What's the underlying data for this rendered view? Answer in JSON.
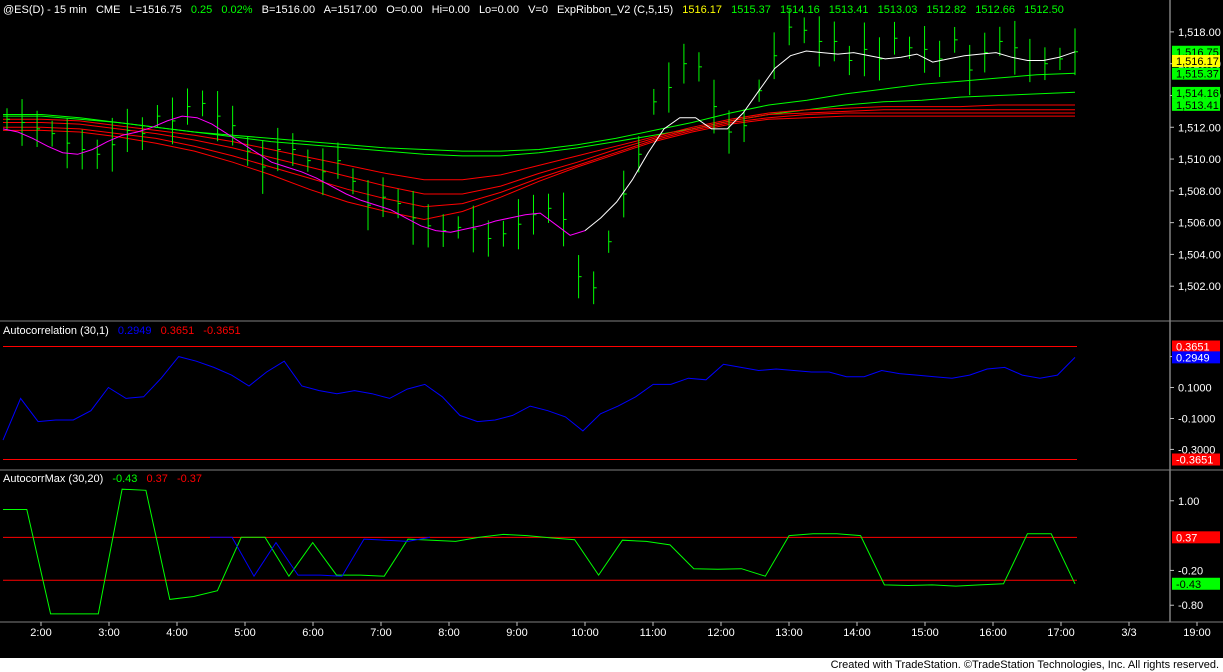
{
  "header": {
    "symbol": "@ES(D) - 15 min",
    "exchange": "CME",
    "last": "L=1516.75",
    "change": "0.25",
    "change_pct": "0.02%",
    "bid": "B=1516.00",
    "ask": "A=1517.00",
    "open": "O=0.00",
    "hi": "Hi=0.00",
    "lo": "Lo=0.00",
    "vol": "V=0",
    "ribbon_name": "ExpRibbon_V2 (C,5,15)",
    "ribbon_values": [
      "1516.17",
      "1515.37",
      "1514.16",
      "1513.41",
      "1513.03",
      "1512.82",
      "1512.66",
      "1512.50"
    ]
  },
  "panel2_header": {
    "name": "Autocorrelation (30,1)",
    "values": [
      "0.2949",
      "0.3651",
      "-0.3651"
    ]
  },
  "panel3_header": {
    "name": "AutocorrMax (30,20)",
    "values": [
      "-0.43",
      "0.37",
      "-0.37"
    ]
  },
  "footer": {
    "text": "Created with TradeStation. ©TradeStation Technologies, Inc. All rights reserved."
  },
  "colors": {
    "background": "#000000",
    "bar": "#00ff00",
    "price_line": "#ffffff",
    "ribbon_green": "#00ff00",
    "ribbon_red": "#ff0000",
    "autocorr_line": "#0000ff",
    "threshold_line": "#ff0000",
    "tag_red": "#ff0000",
    "tag_blue": "#0000ff",
    "tag_yellow": "#ffff00",
    "tag_green": "#00ff00"
  },
  "chart_data": [
    {
      "type": "line",
      "name": "price",
      "ylim": [
        1500,
        1519
      ],
      "ytick_labels": [
        "1,518.00",
        "1,516.00",
        "1,514.00",
        "1,512.00",
        "1,510.00",
        "1,508.00",
        "1,506.00",
        "1,504.00",
        "1,502.00"
      ],
      "yticks": [
        1518,
        1516,
        1514,
        1512,
        1510,
        1508,
        1506,
        1504,
        1502
      ],
      "value_tags": [
        {
          "label": "1,516.75",
          "value": 1516.75,
          "color": "#00ff00"
        },
        {
          "label": "1,516.17",
          "value": 1516.17,
          "color": "#ffff00"
        },
        {
          "label": "1,515.37",
          "value": 1515.37,
          "color": "#00ff00"
        },
        {
          "label": "1,514.16",
          "value": 1514.16,
          "color": "#00ff00"
        },
        {
          "label": "1,513.41",
          "value": 1513.41,
          "color": "#00ff00"
        }
      ],
      "series": [
        {
          "color": "#00ff00",
          "role": "bars",
          "values": [
            1512.5,
            1512.3,
            1511.9,
            1511.6,
            1511.0,
            1510.6,
            1510.3,
            1510.9,
            1511.8,
            1511.6,
            1512.7,
            1512.4,
            1513.3,
            1513.5,
            1512.7,
            1512.1,
            1510.5,
            1509.5,
            1510.6,
            1510.6,
            1509.9,
            1509.2,
            1509.9,
            1508.6,
            1507.1,
            1507.6,
            1507.2,
            1506.3,
            1505.8,
            1505.5,
            1505.7,
            1505.6,
            1505.0,
            1505.3,
            1505.9,
            1506.5,
            1506.9,
            1506.2,
            1502.6,
            1501.9,
            1504.8,
            1507.8,
            1510.3,
            1513.6,
            1514.5,
            1516.0,
            1515.8,
            1513.3,
            1511.7,
            1512.1,
            1514.3,
            1516.5,
            1518.3,
            1518.1,
            1517.4,
            1517.4,
            1516.2,
            1516.9,
            1516.3,
            1517.6,
            1517.0,
            1516.9,
            1516.3,
            1517.5,
            1515.6,
            1516.7,
            1517.4,
            1517.0,
            1516.2,
            1516.0,
            1516.3,
            1516.75
          ]
        },
        {
          "color": "#ff00ff",
          "role": "close-before-turn",
          "values": [
            1511.9,
            1511.7,
            1511.3,
            1510.8,
            1510.4,
            1510.3,
            1510.6,
            1511.1,
            1511.5,
            1511.7,
            1512.0,
            1512.4,
            1512.7,
            1512.6,
            1512.2,
            1511.6,
            1511.0,
            1510.4,
            1509.8,
            1509.5,
            1509.2,
            1508.8,
            1508.3,
            1507.8,
            1507.4,
            1507.1,
            1506.8,
            1506.3,
            1505.8,
            1505.5,
            1505.4,
            1505.6,
            1505.8,
            1506.1,
            1506.3,
            1506.5,
            1506.6,
            1505.9,
            1505.2,
            1505.5
          ]
        },
        {
          "color": "#ffffff",
          "role": "close-after-turn",
          "values": [
            1505.5,
            1506.3,
            1507.3,
            1508.7,
            1510.4,
            1511.9,
            1512.6,
            1512.6,
            1511.9,
            1511.9,
            1512.9,
            1514.3,
            1515.7,
            1516.5,
            1516.8,
            1516.7,
            1516.6,
            1516.7,
            1516.5,
            1516.3,
            1516.4,
            1516.6,
            1516.1,
            1516.3,
            1516.5,
            1516.6,
            1516.7,
            1516.4,
            1516.2,
            1516.2,
            1516.4,
            1516.75
          ]
        },
        {
          "color": "#00ff00",
          "role": "ribbon",
          "values": [
            1512.8,
            1512.8,
            1512.6,
            1512.3,
            1512.0,
            1511.7,
            1511.5,
            1511.3,
            1511.1,
            1510.9,
            1510.7,
            1510.6,
            1510.5,
            1510.5,
            1510.6,
            1510.9,
            1511.3,
            1511.8,
            1512.3,
            1512.9,
            1513.4,
            1513.7,
            1514.1,
            1514.4,
            1514.7,
            1514.9,
            1515.1,
            1515.3,
            1515.4
          ]
        },
        {
          "color": "#00ff00",
          "role": "ribbon",
          "values": [
            1512.7,
            1512.7,
            1512.5,
            1512.3,
            1512.0,
            1511.7,
            1511.4,
            1511.1,
            1510.9,
            1510.7,
            1510.5,
            1510.3,
            1510.2,
            1510.2,
            1510.4,
            1510.7,
            1511.1,
            1511.5,
            1511.9,
            1512.4,
            1512.8,
            1513.1,
            1513.4,
            1513.6,
            1513.7,
            1513.9,
            1514.0,
            1514.1,
            1514.2
          ]
        },
        {
          "color": "#ff0000",
          "role": "ribbon",
          "values": [
            1512.5,
            1512.5,
            1512.4,
            1512.1,
            1511.8,
            1511.5,
            1511.1,
            1510.6,
            1510.1,
            1509.6,
            1509.1,
            1508.7,
            1508.7,
            1509.0,
            1509.6,
            1510.2,
            1510.8,
            1511.4,
            1512.0,
            1512.5,
            1512.9,
            1513.1,
            1513.2,
            1513.3,
            1513.3,
            1513.3,
            1513.4,
            1513.4,
            1513.4
          ]
        },
        {
          "color": "#ff0000",
          "role": "ribbon",
          "values": [
            1512.3,
            1512.3,
            1512.2,
            1511.9,
            1511.6,
            1511.2,
            1510.7,
            1510.1,
            1509.5,
            1508.9,
            1508.3,
            1507.8,
            1507.8,
            1508.3,
            1509.1,
            1509.8,
            1510.6,
            1511.3,
            1511.9,
            1512.4,
            1512.8,
            1512.9,
            1513.0,
            1513.1,
            1513.1,
            1513.1,
            1513.1,
            1513.1,
            1513.1
          ]
        },
        {
          "color": "#ff0000",
          "role": "ribbon",
          "values": [
            1512.0,
            1512.0,
            1511.9,
            1511.6,
            1511.3,
            1510.8,
            1510.2,
            1509.5,
            1508.8,
            1508.1,
            1507.5,
            1507.0,
            1507.2,
            1507.9,
            1508.8,
            1509.6,
            1510.4,
            1511.2,
            1511.8,
            1512.3,
            1512.6,
            1512.8,
            1512.9,
            1512.9,
            1512.9,
            1512.9,
            1512.9,
            1512.9,
            1512.9
          ]
        },
        {
          "color": "#ff0000",
          "role": "ribbon",
          "values": [
            1511.8,
            1511.8,
            1511.7,
            1511.4,
            1511.0,
            1510.5,
            1509.8,
            1509.0,
            1508.1,
            1507.3,
            1506.7,
            1506.2,
            1506.7,
            1507.6,
            1508.6,
            1509.5,
            1510.3,
            1511.1,
            1511.7,
            1512.2,
            1512.5,
            1512.6,
            1512.7,
            1512.7,
            1512.7,
            1512.7,
            1512.7,
            1512.7,
            1512.7
          ]
        }
      ]
    },
    {
      "type": "line",
      "name": "autocorrelation",
      "ylim": [
        -0.42,
        0.42
      ],
      "ytick_labels": [
        "0.3000",
        "0.1000",
        "-0.1000",
        "-0.3000"
      ],
      "yticks": [
        0.3,
        0.1,
        -0.1,
        -0.3
      ],
      "thresholds": [
        0.3651,
        -0.3651
      ],
      "value_tags": [
        {
          "label": "0.3651",
          "value": 0.3651,
          "color": "#ff0000"
        },
        {
          "label": "0.2949",
          "value": 0.2949,
          "color": "#0000ff"
        },
        {
          "label": "-0.3651",
          "value": -0.3651,
          "color": "#ff0000"
        }
      ],
      "series": [
        {
          "color": "#0000ff",
          "values": [
            -0.24,
            0.03,
            -0.12,
            -0.11,
            -0.11,
            -0.05,
            0.1,
            0.03,
            0.04,
            0.16,
            0.3,
            0.27,
            0.23,
            0.18,
            0.11,
            0.2,
            0.27,
            0.11,
            0.08,
            0.06,
            0.08,
            0.06,
            0.03,
            0.09,
            0.12,
            0.04,
            -0.08,
            -0.12,
            -0.11,
            -0.08,
            -0.02,
            -0.05,
            -0.09,
            -0.18,
            -0.07,
            -0.02,
            0.04,
            0.12,
            0.12,
            0.16,
            0.15,
            0.25,
            0.23,
            0.21,
            0.22,
            0.21,
            0.2,
            0.2,
            0.17,
            0.17,
            0.21,
            0.19,
            0.18,
            0.17,
            0.16,
            0.18,
            0.22,
            0.23,
            0.18,
            0.16,
            0.18,
            0.2949
          ]
        }
      ]
    },
    {
      "type": "line",
      "name": "autocorrmax",
      "ylim": [
        -1.02,
        1.22
      ],
      "ytick_labels": [
        "1.00",
        "-0.20",
        "-0.80"
      ],
      "yticks": [
        1.0,
        -0.2,
        -0.8
      ],
      "thresholds": [
        0.37,
        -0.37
      ],
      "value_tags": [
        {
          "label": "0.37",
          "value": 0.37,
          "color": "#ff0000"
        },
        {
          "label": "-0.43",
          "value": -0.43,
          "color": "#00ff00"
        }
      ],
      "series": [
        {
          "color": "#00ff00",
          "role": "main",
          "values": [
            0.85,
            0.85,
            -0.95,
            -0.95,
            -0.95,
            1.2,
            1.18,
            -0.7,
            -0.65,
            -0.55,
            0.37,
            0.37,
            -0.3,
            0.28,
            -0.28,
            -0.28,
            -0.3,
            0.34,
            0.32,
            0.3,
            0.37,
            0.42,
            0.4,
            0.36,
            0.33,
            -0.28,
            0.32,
            0.3,
            0.24,
            -0.17,
            -0.18,
            -0.17,
            -0.3,
            0.4,
            0.43,
            0.43,
            0.4,
            -0.45,
            -0.46,
            -0.45,
            -0.47,
            -0.45,
            -0.43,
            0.43,
            0.43,
            -0.43
          ]
        },
        {
          "color": "#0000ff",
          "role": "segment-blue",
          "values": [
            0.37,
            0.37,
            -0.3,
            0.28,
            -0.28,
            -0.28,
            -0.3,
            0.34,
            0.32,
            0.3,
            0.37
          ]
        }
      ]
    }
  ],
  "x_axis": {
    "labels": [
      "2:00",
      "3:00",
      "4:00",
      "5:00",
      "6:00",
      "7:00",
      "8:00",
      "9:00",
      "10:00",
      "11:00",
      "12:00",
      "13:00",
      "14:00",
      "15:00",
      "16:00",
      "17:00",
      "3/3",
      "19:00"
    ]
  }
}
